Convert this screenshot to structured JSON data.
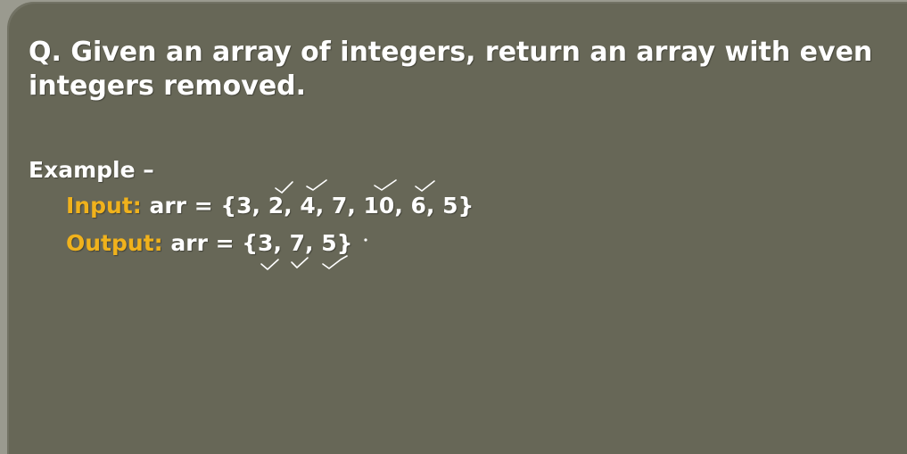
{
  "question": {
    "line1": "Q. Given an array of integers, return an array with even",
    "line2": "integers removed."
  },
  "example": {
    "heading": "Example –",
    "input_label": "Input:",
    "input_value": "arr = {3, 2, 4, 7, 10, 6, 5}",
    "output_label": "Output:",
    "output_value": "arr = {3, 7, 5}"
  },
  "colors": {
    "background": "#676757",
    "text": "#ffffff",
    "label": "#f0b21c"
  }
}
